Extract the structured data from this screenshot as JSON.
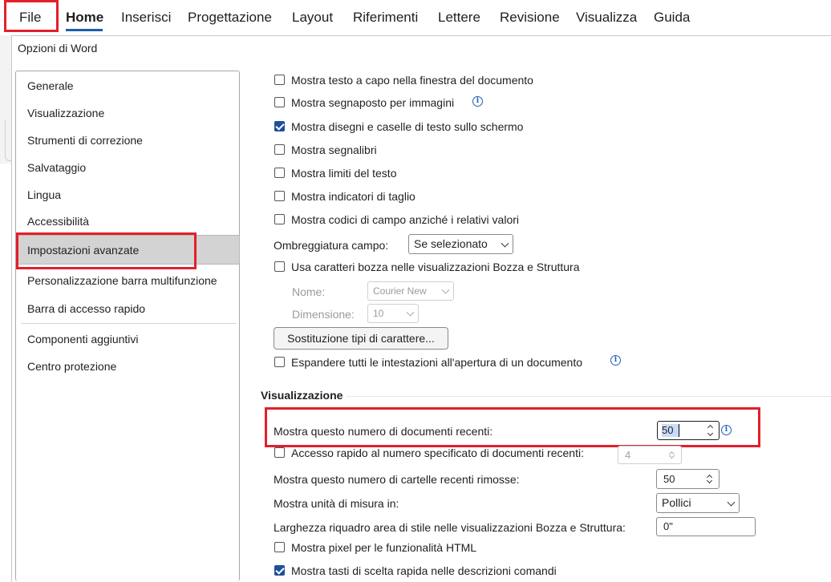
{
  "ribbon": {
    "tabs": [
      "File",
      "Home",
      "Inserisci",
      "Progettazione",
      "Layout",
      "Riferimenti",
      "Lettere",
      "Revisione",
      "Visualizza",
      "Guida"
    ]
  },
  "dialog": {
    "title": "Opzioni di Word"
  },
  "sidebar": {
    "items": [
      "Generale",
      "Visualizzazione",
      "Strumenti di correzione",
      "Salvataggio",
      "Lingua",
      "Accessibilità",
      "Impostazioni avanzate",
      "Personalizzazione barra multifunzione",
      "Barra di accesso rapido",
      "Componenti aggiuntivi",
      "Centro protezione"
    ],
    "selected": "Impostazioni avanzate"
  },
  "content": {
    "wrap_text": {
      "label": "Mostra testo a capo nella finestra del documento",
      "checked": false
    },
    "placeholders": {
      "label": "Mostra segnaposto per immagini",
      "checked": false
    },
    "drawings": {
      "label": "Mostra disegni e caselle di testo sullo schermo",
      "checked": true
    },
    "bookmarks": {
      "label": "Mostra segnalibri",
      "checked": false
    },
    "text_bounds": {
      "label": "Mostra limiti del testo",
      "checked": false
    },
    "crop_marks": {
      "label": "Mostra indicatori di taglio",
      "checked": false
    },
    "field_codes": {
      "label": "Mostra codici di campo anziché i relativi valori",
      "checked": false
    },
    "field_shading": {
      "label": "Ombreggiatura campo:",
      "value": "Se selezionato"
    },
    "draft_font": {
      "label": "Usa caratteri bozza nelle visualizzazioni Bozza e Struttura",
      "checked": false
    },
    "font_name": {
      "label": "Nome:",
      "value": "Courier New"
    },
    "font_size": {
      "label": "Dimensione:",
      "value": "10"
    },
    "font_substitution_button": "Sostituzione tipi di carattere...",
    "expand_headings": {
      "label": "Espandere tutti le intestazioni all'apertura di un documento",
      "checked": false
    }
  },
  "visualizzazione": {
    "section_title": "Visualizzazione",
    "recent_docs": {
      "label": "Mostra questo numero di documenti recenti:",
      "value": "50"
    },
    "quick_access": {
      "label": "Accesso rapido al numero specificato di documenti recenti:",
      "value": "4",
      "checked": false
    },
    "recent_folders": {
      "label": "Mostra questo numero di cartelle recenti rimosse:",
      "value": "50"
    },
    "units": {
      "label": "Mostra unità di misura in:",
      "value": "Pollici"
    },
    "style_width": {
      "label": "Larghezza riquadro area di stile nelle visualizzazioni Bozza e Struttura:",
      "value": "0\""
    },
    "pixels_html": {
      "label": "Mostra pixel per le funzionalità HTML",
      "checked": false
    },
    "shortcut_keys": {
      "label": "Mostra tasti di scelta rapida nelle descrizioni comandi",
      "checked": true
    }
  },
  "colors": {
    "highlight": "#e2202a",
    "accent": "#1f4e9c"
  }
}
